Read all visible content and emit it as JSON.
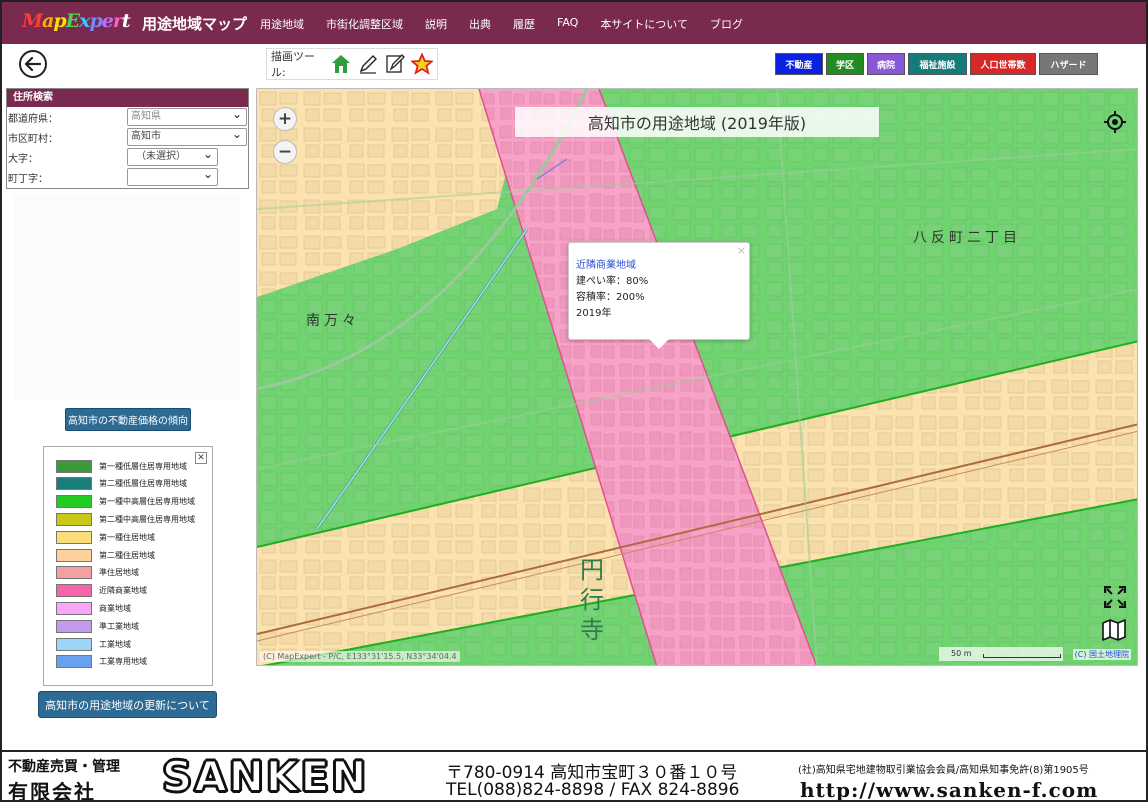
{
  "header": {
    "logo": "MapExpert",
    "app_title": "用途地域マップ",
    "nav": [
      "用途地域",
      "市街化調整区域",
      "説明",
      "出典",
      "履歴",
      "FAQ",
      "本サイトについて",
      "ブログ"
    ]
  },
  "toolbar": {
    "back_icon": "back-arrow-icon",
    "draw_label": "描画ツール:",
    "tools": [
      "home-marker-icon",
      "pencil-icon",
      "note-edit-icon",
      "star-icon"
    ],
    "categories": [
      {
        "label": "不動産",
        "color": "#0a22e0"
      },
      {
        "label": "学区",
        "color": "#228b22"
      },
      {
        "label": "病院",
        "color": "#8a58d6"
      },
      {
        "label": "福祉施設",
        "color": "#157a7a"
      },
      {
        "label": "人口世帯数",
        "color": "#d62828"
      },
      {
        "label": "ハザード",
        "color": "#777777"
      }
    ]
  },
  "address_search": {
    "title": "住所検索",
    "prefecture_label": "都道府県：",
    "prefecture_value": "高知県",
    "city_label": "市区町村：",
    "city_value": "高知市",
    "oaza_label": "大字：",
    "oaza_value": "（未選択）",
    "chome_label": "町丁字：",
    "chome_value": ""
  },
  "buttons": {
    "price_trend": "高知市の不動産価格の傾向",
    "update_info": "高知市の用途地域の更新について"
  },
  "legend": {
    "close": "✕",
    "items": [
      {
        "label": "第一種低層住居専用地域",
        "color": "#3a9a3a"
      },
      {
        "label": "第二種低層住居専用地域",
        "color": "#1a7f7a"
      },
      {
        "label": "第一種中高層住居専用地域",
        "color": "#22cc22"
      },
      {
        "label": "第二種中高層住居専用地域",
        "color": "#c8c818"
      },
      {
        "label": "第一種住居地域",
        "color": "#fddc7a"
      },
      {
        "label": "第二種住居地域",
        "color": "#fcd19c"
      },
      {
        "label": "準住居地域",
        "color": "#f4a0a0"
      },
      {
        "label": "近隣商業地域",
        "color": "#f564a8"
      },
      {
        "label": "商業地域",
        "color": "#f9a6f9"
      },
      {
        "label": "準工業地域",
        "color": "#c49af0"
      },
      {
        "label": "工業地域",
        "color": "#9dd4f8"
      },
      {
        "label": "工業専用地域",
        "color": "#6aa0f0"
      }
    ]
  },
  "map": {
    "title": "高知市の用途地域 (2019年版)",
    "zoom_in": "+",
    "zoom_out": "−",
    "popup": {
      "title": "近隣商業地域",
      "line1": "建ぺい率：80%",
      "line2": "容積率：200%",
      "line3": "2019年",
      "close": "×"
    },
    "place_names": {
      "yasumachi": "八反町二丁目",
      "minami": "南万々",
      "enkoji": "円行寺"
    },
    "attribution": "(C) MapExpert - P/C, E133°31'15.5, N33°34'04.4",
    "scale": "50 m",
    "gsi": "(C) 国土地理院"
  },
  "footer": {
    "tagline": "不動産売買・管理",
    "company": "有限会社",
    "brand": "SANKEN",
    "address": "〒780-0914  高知市宝町３０番１０号",
    "tel": "TEL(088)824-8898 / FAX 824-8896",
    "association": "(社)高知県宅地建物取引業協会会員/高知県知事免許(8)第1905号",
    "url": "http://www.sanken-f.com"
  }
}
